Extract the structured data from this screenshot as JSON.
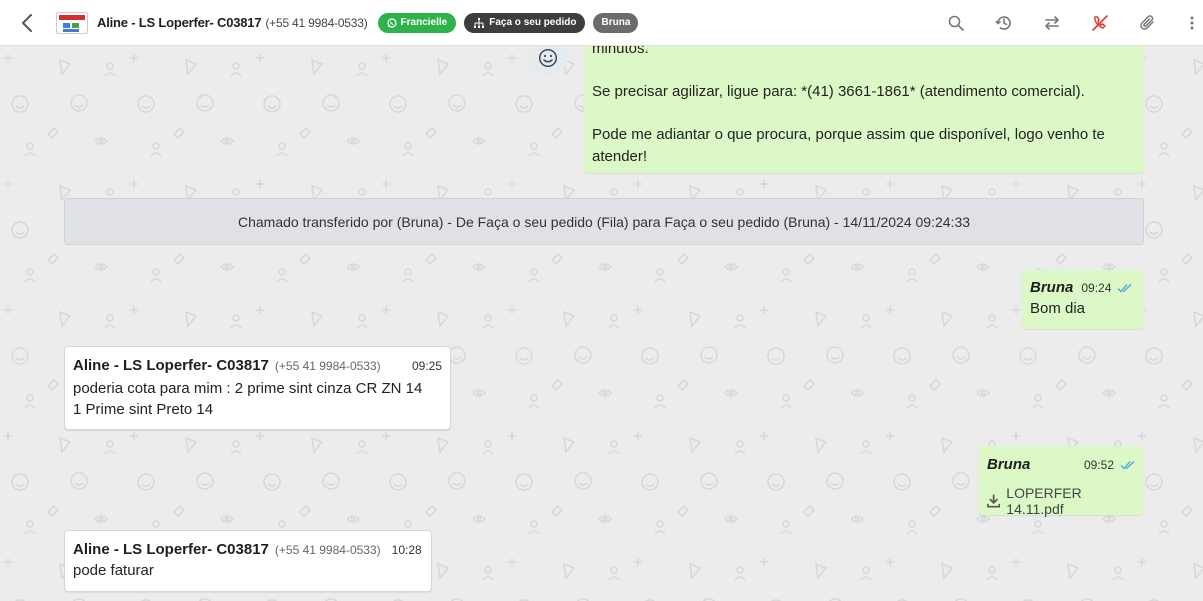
{
  "header": {
    "contact_name": "Aline - LS Loperfer- C03817",
    "contact_phone": "(+55 41 9984-0533)",
    "tags": [
      {
        "label": "Francielle",
        "color": "#2db34a",
        "icon": "whatsapp-icon"
      },
      {
        "label": "Faça o seu pedido",
        "color": "#3d3d3d",
        "icon": "sitemap-icon"
      },
      {
        "label": "Bruna",
        "color": "#6b6b6b"
      }
    ],
    "toolbar_icons": [
      "search-icon",
      "history-icon",
      "transfer-icon",
      "close-ticket-icon",
      "attachment-icon",
      "more-vert-icon"
    ]
  },
  "chat": {
    "greeting": {
      "partial_line": "minutos.",
      "line2": "Se precisar agilizar, ligue para: *(41) 3661-1861* (atendimento comercial).",
      "line3": "Pode me adiantar o que procura, porque assim que disponível, logo venho te atender!"
    },
    "system_note": "Chamado transferido por (Bruna) - De Faça o seu pedido (Fila) para Faça o seu pedido (Bruna) - 14/11/2024 09:24:33",
    "messages": [
      {
        "sender": "Bruna",
        "time": "09:24",
        "text": "Bom dia"
      },
      {
        "sender": "Aline - LS Loperfer- C03817",
        "phone": "(+55 41 9984-0533)",
        "time": "09:25",
        "line1": "poderia cota para mim : 2 prime sint cinza CR ZN 14",
        "line2": "1 Prime sint Preto 14"
      },
      {
        "sender": "Bruna",
        "time": "09:52",
        "attachment": "LOPERFER 14.11.pdf"
      },
      {
        "sender": "Aline - LS Loperfer- C03817",
        "phone": "(+55 41 9984-0533)",
        "time": "10:28",
        "text": "pode faturar"
      }
    ]
  },
  "colors": {
    "outgoing_bubble": "#dcf8c6",
    "incoming_bubble": "#ffffff",
    "chat_background": "#ececec",
    "read_ticks": "#4fa3e0"
  }
}
